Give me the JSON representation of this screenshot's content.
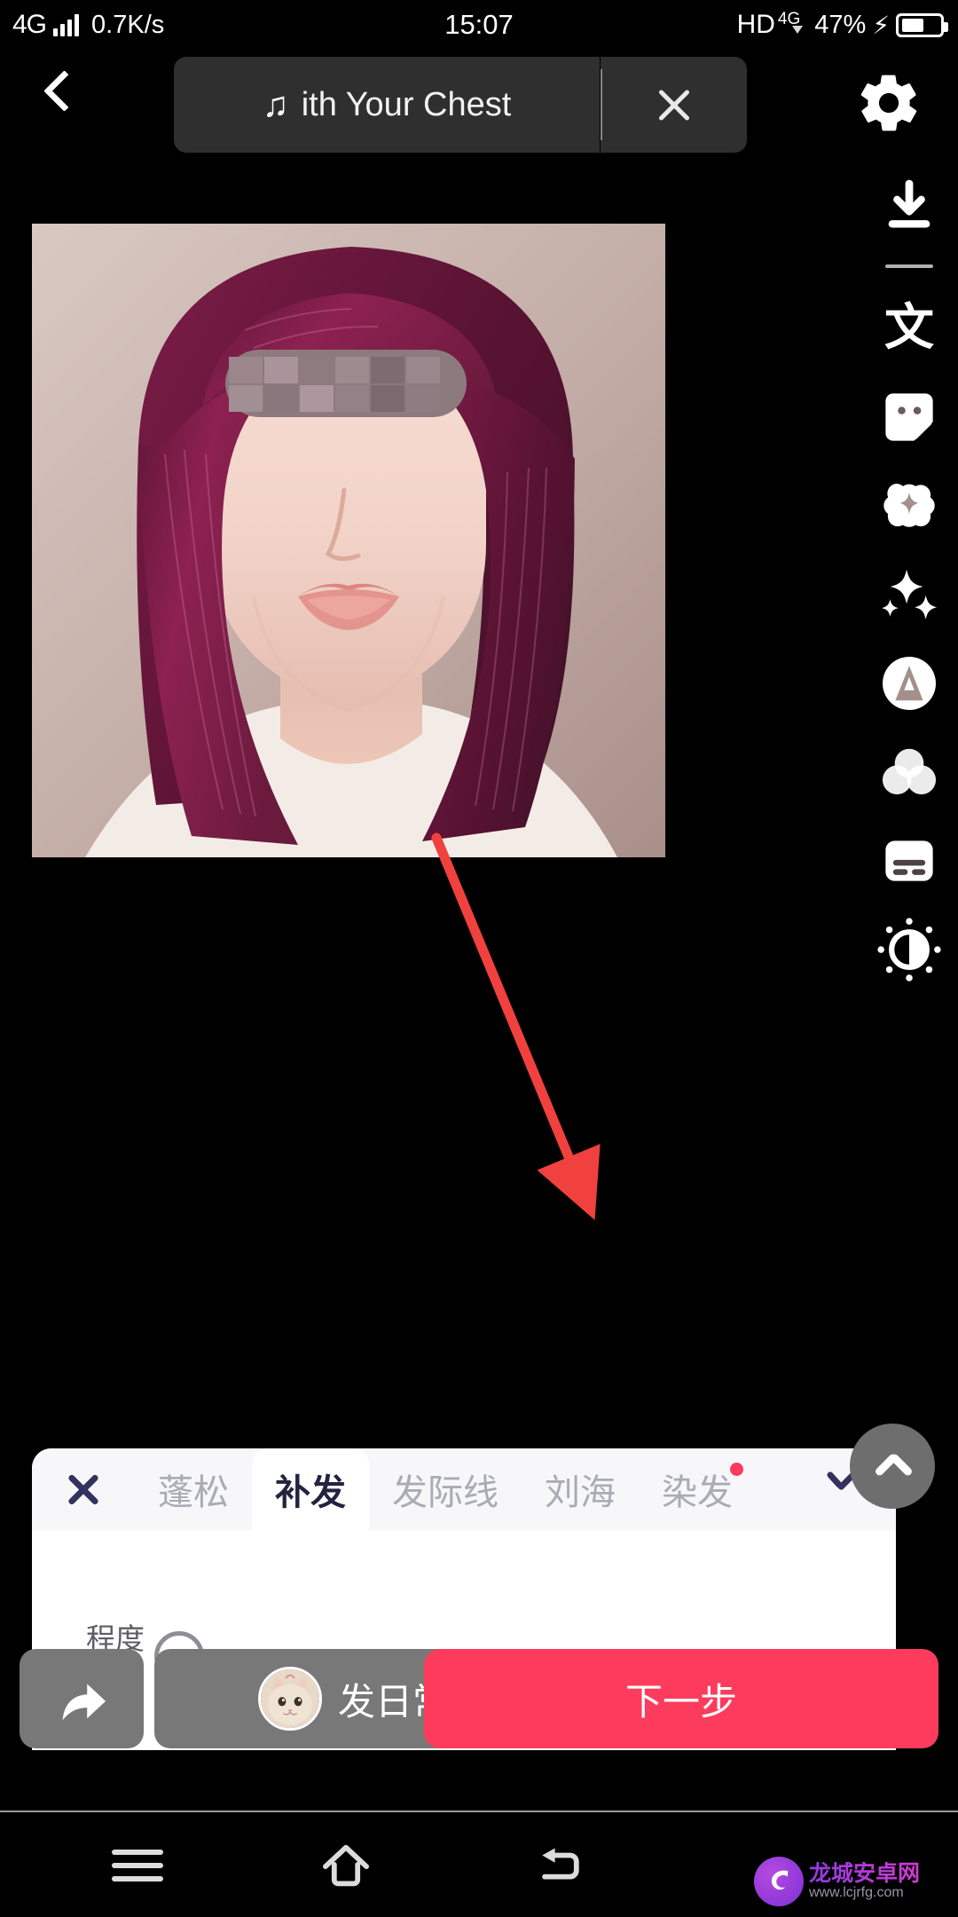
{
  "status_bar": {
    "network_type": "4G",
    "speed": "0.7K/s",
    "time": "15:07",
    "hd": "HD",
    "voice_net": "4G",
    "battery_percent": "47%",
    "charging_icon": "bolt-icon",
    "signal_icon": "signal-bars-icon",
    "battery_icon": "battery-icon"
  },
  "top_bar": {
    "back_icon": "chevron-left-icon",
    "music_icon": "music-note-icon",
    "music_title": "ith Your Chest",
    "close_icon": "close-icon",
    "settings_icon": "gear-icon"
  },
  "tool_column": [
    {
      "name": "download-icon",
      "label": ""
    },
    {
      "name": "divider",
      "label": ""
    },
    {
      "name": "text-icon",
      "label": "文"
    },
    {
      "name": "sticker-icon",
      "label": ""
    },
    {
      "name": "beautify-icon",
      "label": ""
    },
    {
      "name": "sparkle-icon",
      "label": ""
    },
    {
      "name": "letter-a-icon",
      "label": ""
    },
    {
      "name": "filter-circles-icon",
      "label": ""
    },
    {
      "name": "caption-card-icon",
      "label": ""
    },
    {
      "name": "brightness-icon",
      "label": ""
    }
  ],
  "editor_panel": {
    "cancel_icon": "close-icon",
    "confirm_icon": "check-icon",
    "collapse_icon": "chevron-up-icon",
    "tabs": [
      {
        "label": "蓬松",
        "active": false,
        "badge": false
      },
      {
        "label": "补发",
        "active": true,
        "badge": false
      },
      {
        "label": "发际线",
        "active": false,
        "badge": false
      },
      {
        "label": "刘海",
        "active": false,
        "badge": false
      },
      {
        "label": "染发",
        "active": false,
        "badge": true
      }
    ],
    "degree_label": "程度",
    "slider_knob": "slider-handle"
  },
  "action_bar": {
    "share_icon": "share-arrow-icon",
    "daily_label": "发日常",
    "daily_avatar": "cat-avatar",
    "next_label": "下一步",
    "next_color": "#fd3b5c"
  },
  "nav_bar": {
    "menu_icon": "menu-icon",
    "home_icon": "home-icon",
    "back_icon": "back-arrow-icon"
  },
  "annotation": {
    "arrow_color": "#f0413f",
    "arrow_from": "(492, 944)",
    "arrow_to": "(660, 1350)"
  },
  "watermark": {
    "site_name": "龙城安卓网",
    "url": "www.lcjrfg.com",
    "logo_icon": "dragon-logo-icon"
  },
  "photo": {
    "description": "portrait-photo",
    "censor_bar": "mosaic-bar"
  }
}
